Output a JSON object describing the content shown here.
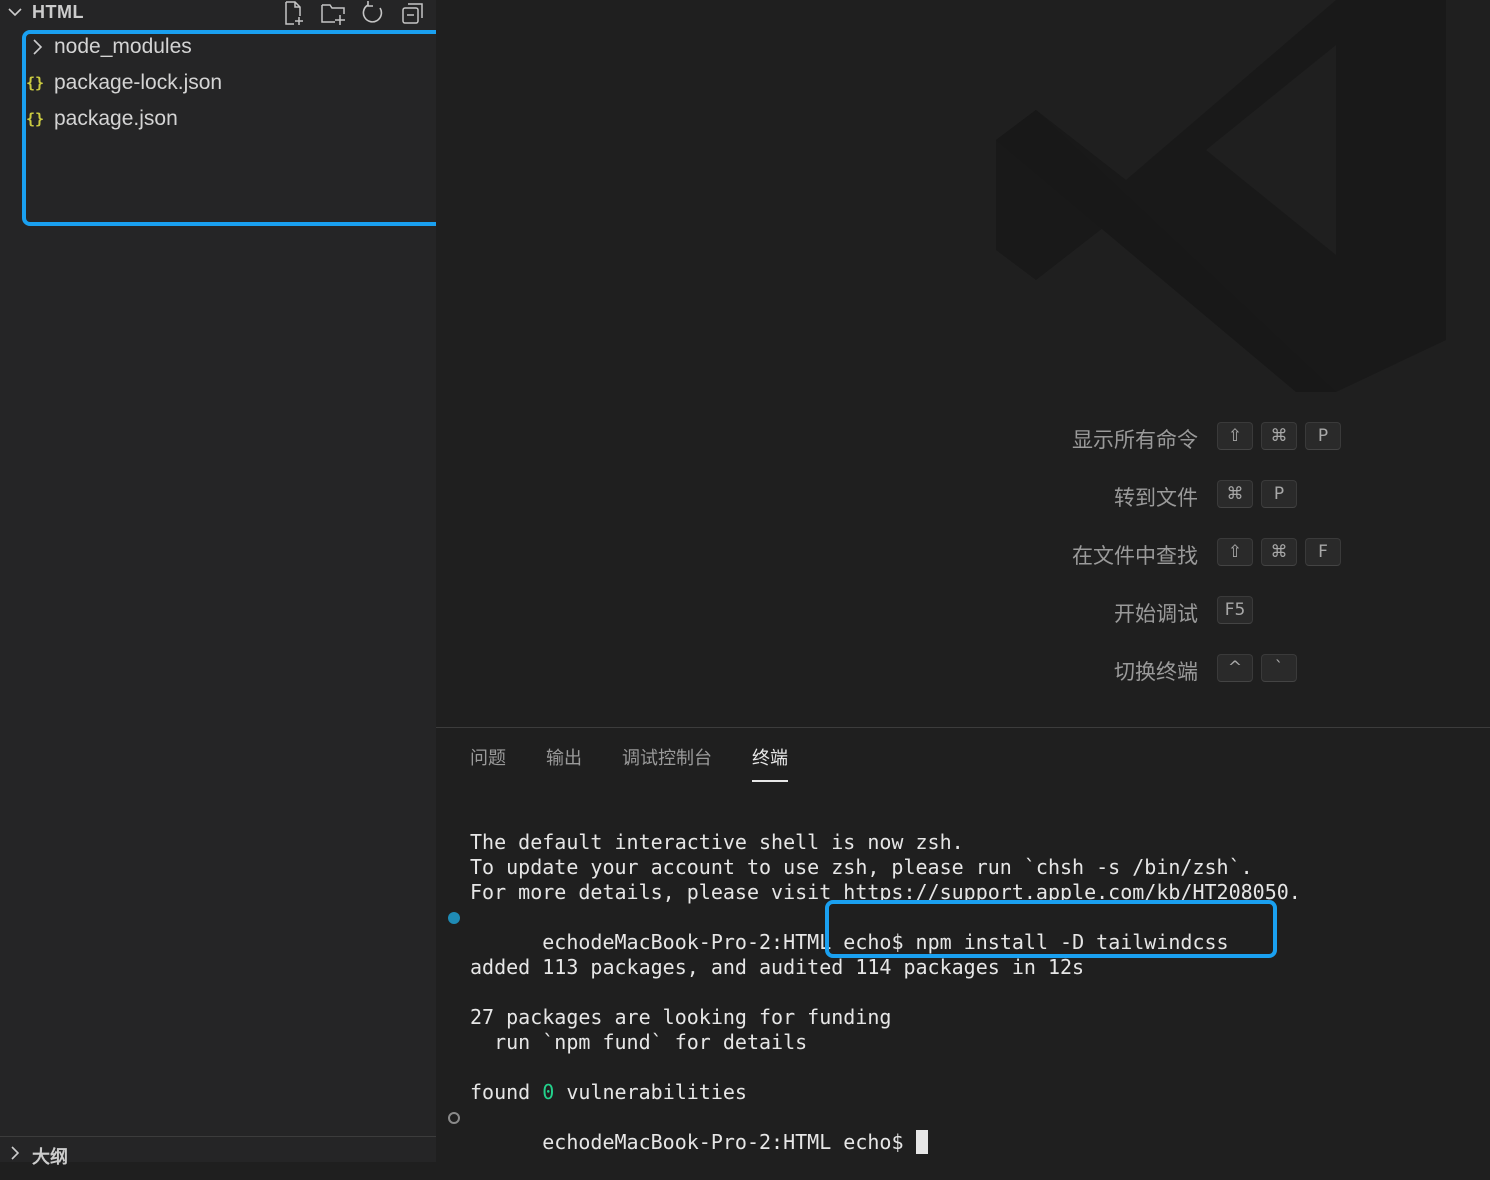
{
  "explorer": {
    "title": "HTML",
    "items": [
      {
        "label": "node_modules",
        "type": "folder"
      },
      {
        "label": "package-lock.json",
        "type": "json"
      },
      {
        "label": "package.json",
        "type": "json"
      }
    ],
    "json_icon_glyph": "{}",
    "outline_title": "大纲"
  },
  "editor": {
    "shortcuts": [
      {
        "label": "显示所有命令",
        "keys": [
          "⇧",
          "⌘",
          "P"
        ]
      },
      {
        "label": "转到文件",
        "keys": [
          "⌘",
          "P"
        ]
      },
      {
        "label": "在文件中查找",
        "keys": [
          "⇧",
          "⌘",
          "F"
        ]
      },
      {
        "label": "开始调试",
        "keys": [
          "F5"
        ]
      },
      {
        "label": "切换终端",
        "keys": [
          "^",
          "`"
        ]
      }
    ]
  },
  "panel": {
    "tabs": [
      "问题",
      "输出",
      "调试控制台",
      "终端"
    ],
    "active_tab": "终端",
    "terminal": {
      "line1": "The default interactive shell is now zsh.",
      "line2": "To update your account to use zsh, please run `chsh -s /bin/zsh`.",
      "line3": "For more details, please visit https://support.apple.com/kb/HT208050.",
      "prompt": "echodeMacBook-Pro-2:HTML echo$",
      "command": "npm install -D tailwindcss",
      "line5": "added 113 packages, and audited 114 packages in 12s",
      "line6": "27 packages are looking for funding",
      "line7": "  run `npm fund` for details",
      "found_prefix": "found",
      "found_count": "0",
      "found_suffix": "vulnerabilities",
      "prompt2": "echodeMacBook-Pro-2:HTML echo$"
    }
  },
  "colors": {
    "highlight": "#1aa0f0",
    "json_icon": "#cbcb41",
    "success_green": "#23d18b",
    "prompt_decoration": "#1f8bb5"
  }
}
